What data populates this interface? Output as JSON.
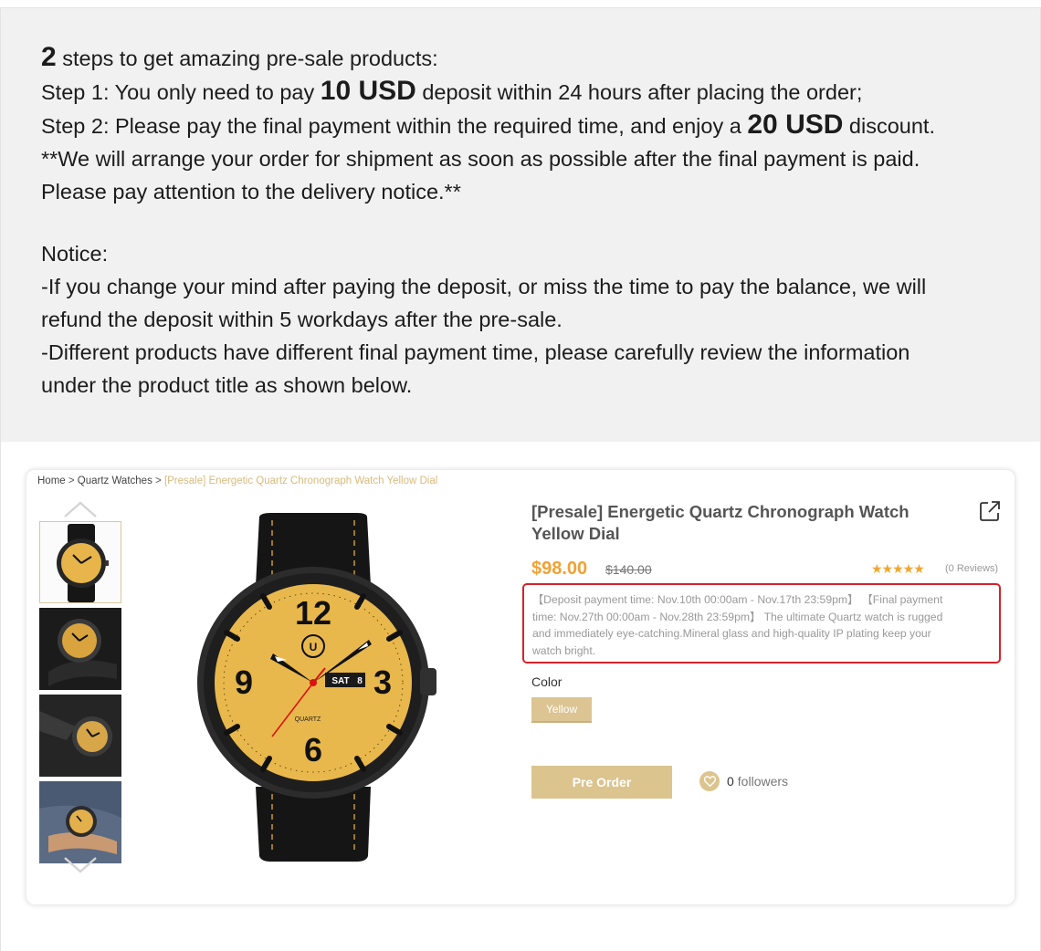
{
  "intro": {
    "line1_num": "2",
    "line1_text": " steps to get amazing pre-sale products:",
    "line2_a": "Step 1: You only need to pay ",
    "line2_big": "10 USD",
    "line2_b": " deposit within 24 hours after placing the order;",
    "line3_a": "Step 2: Please pay the final payment within the required time, and enjoy a ",
    "line3_big": "20 USD",
    "line3_b": " discount.",
    "line4": "**We will arrange your order for shipment as soon as possible after the final payment is paid.",
    "line5": "Please pay attention to the delivery notice.**",
    "notice_heading": "Notice:",
    "notice1a": "-If you change your mind after paying the deposit, or miss the time to pay the balance, we will",
    "notice1b": "refund the deposit within 5 workdays after the pre-sale.",
    "notice2a": "-Different products have different final payment time, please carefully review the information",
    "notice2b": "under the product title as shown below."
  },
  "breadcrumb": {
    "home": "Home",
    "sep": " > ",
    "category": "Quartz Watches",
    "current": "[Presale] Energetic Quartz Chronograph Watch Yellow Dial"
  },
  "product": {
    "title_line1": "[Presale] Energetic Quartz Chronograph Watch",
    "title_line2": "Yellow Dial",
    "price": "$98.00",
    "old_price": "$140.00",
    "stars": "★★★★★",
    "reviews": "(0 Reviews)",
    "notice_line1": "【Deposit payment time: Nov.10th 00:00am - Nov.17th 23:59pm】 【Final payment",
    "notice_line2": "time: Nov.27th 00:00am - Nov.28th 23:59pm】 The ultimate Quartz watch is rugged",
    "notice_line3": "and immediately eye-catching.Mineral glass and high-quality IP plating keep your",
    "notice_line4": "watch bright.",
    "color_label": "Color",
    "color_option": "Yellow",
    "preorder_label": "Pre Order",
    "followers_count": "0",
    "followers_label": "followers"
  },
  "watch_face": {
    "brand": "QUARTZ",
    "day": "SAT",
    "date": "8",
    "numerals": [
      "12",
      "3",
      "6",
      "9"
    ]
  },
  "colors": {
    "accent_gold": "#dcc48f",
    "price_orange": "#f1a135",
    "notice_border": "#d4222a",
    "dial_yellow": "#e9b84c"
  },
  "icons": {
    "share": "share-external-icon",
    "heart": "heart-icon",
    "arrow_up": "chevron-up-icon",
    "arrow_down": "chevron-down-icon"
  }
}
